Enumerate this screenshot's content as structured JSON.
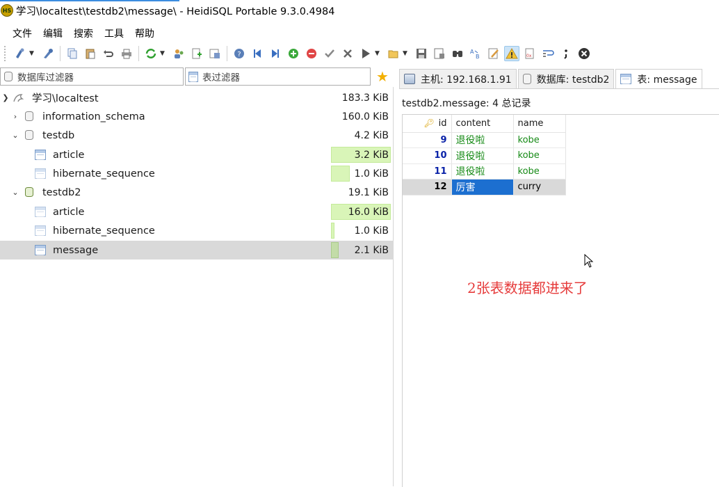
{
  "window": {
    "title": "学习\\localtest\\testdb2\\message\\ - HeidiSQL Portable 9.3.0.4984",
    "app_icon_text": "HS"
  },
  "menu": [
    "文件",
    "编辑",
    "搜索",
    "工具",
    "帮助"
  ],
  "filters": {
    "database_placeholder": "数据库过滤器",
    "table_placeholder": "表过滤器"
  },
  "tree": {
    "root": {
      "label": "学习\\localtest",
      "size": "183.3 KiB"
    },
    "information_schema": {
      "label": "information_schema",
      "size": "160.0 KiB"
    },
    "testdb": {
      "label": "testdb",
      "size": "4.2 KiB",
      "tables": [
        {
          "label": "article",
          "size": "3.2 KiB",
          "fill": 1.0
        },
        {
          "label": "hibernate_sequence",
          "size": "1.0 KiB",
          "fill": 0.31
        }
      ]
    },
    "testdb2": {
      "label": "testdb2",
      "size": "19.1 KiB",
      "tables": [
        {
          "label": "article",
          "size": "16.0 KiB",
          "fill": 1.0
        },
        {
          "label": "hibernate_sequence",
          "size": "1.0 KiB",
          "fill": 0.06
        },
        {
          "label": "message",
          "size": "2.1 KiB",
          "fill": 0.13
        }
      ]
    }
  },
  "tabs": [
    {
      "label": "主机: 192.168.1.91"
    },
    {
      "label": "数据库: testdb2"
    },
    {
      "label": "表: message"
    }
  ],
  "record_info": "testdb2.message: 4 总记录",
  "grid": {
    "columns": [
      "id",
      "content",
      "name"
    ],
    "rows": [
      {
        "id": "9",
        "content": "退役啦",
        "name": "kobe"
      },
      {
        "id": "10",
        "content": "退役啦",
        "name": "kobe"
      },
      {
        "id": "11",
        "content": "退役啦",
        "name": "kobe"
      },
      {
        "id": "12",
        "content": "厉害",
        "name": "curry"
      }
    ]
  },
  "annotation": "2张表数据都进来了",
  "colors": {
    "size_bar": "#d9f5b8",
    "selected_row": "#d9d9d9",
    "focused_cell": "#1c6fd0",
    "id_text": "#0a22a8",
    "text_value": "#168a16",
    "annotation": "#e63c3c"
  }
}
